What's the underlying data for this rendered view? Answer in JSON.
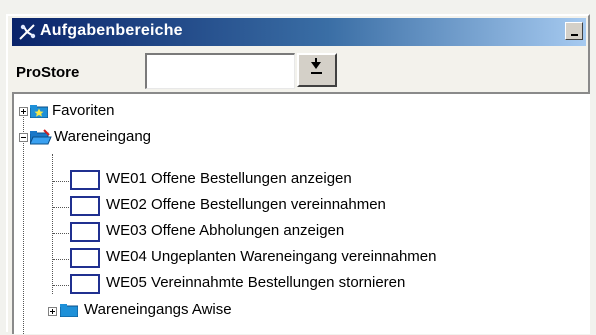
{
  "panel": {
    "title": "Aufgabenbereiche",
    "accent": "#0a246a"
  },
  "store": {
    "label": "ProStore",
    "value": ""
  },
  "tree": {
    "favorites": "Favoriten",
    "wareneingang": {
      "label": "Wareneingang",
      "items": [
        "WE01 Offene Bestellungen anzeigen",
        "WE02 Offene Bestellungen vereinnahmen",
        "WE03 Offene Abholungen anzeigen",
        "WE04 Ungeplanten Wareneingang vereinnahmen",
        "WE05 Vereinnahmte Bestellungen stornieren"
      ]
    },
    "avise": "Wareneingangs Awise"
  }
}
